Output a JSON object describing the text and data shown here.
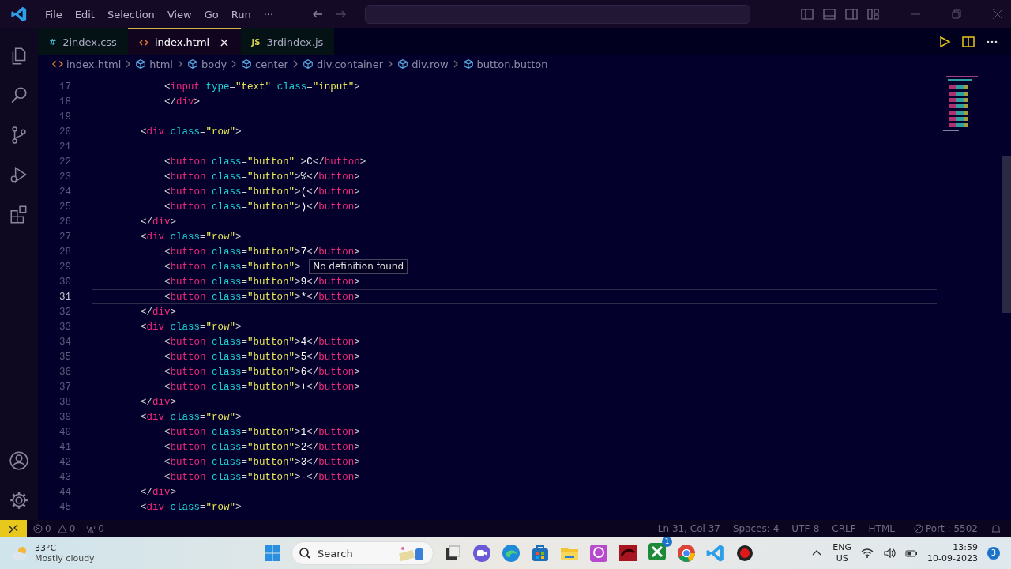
{
  "menu": [
    "File",
    "Edit",
    "Selection",
    "View",
    "Go",
    "Run",
    "···"
  ],
  "tabs": [
    {
      "label": "2index.css",
      "icon": "#",
      "kind": "css",
      "selected": false
    },
    {
      "label": "index.html",
      "kind": "html",
      "selected": true
    },
    {
      "label": "3rdindex.js",
      "icon": "JS",
      "kind": "js",
      "selected": false
    }
  ],
  "close_glyph": "×",
  "breadcrumbs": [
    {
      "label": "index.html",
      "kind": "file"
    },
    {
      "label": "html",
      "kind": "element"
    },
    {
      "label": "body",
      "kind": "element"
    },
    {
      "label": "center",
      "kind": "element"
    },
    {
      "label": "div.container",
      "kind": "element"
    },
    {
      "label": "div.row",
      "kind": "element"
    },
    {
      "label": "button.button",
      "kind": "element"
    }
  ],
  "code_lines": [
    {
      "number": "17",
      "current": false,
      "text": "            <input type=\"text\" class=\"input\">"
    },
    {
      "number": "18",
      "current": false,
      "text": "            </div>"
    },
    {
      "number": "19",
      "current": false
    },
    {
      "number": "20",
      "current": false,
      "text": "        <div class=\"row\">"
    },
    {
      "number": "21",
      "current": false
    },
    {
      "number": "22",
      "current": false,
      "text": "            <button class=\"button\" >C</button>"
    },
    {
      "number": "23",
      "current": false,
      "text": "            <button class=\"button\">%</button>"
    },
    {
      "number": "24",
      "current": false,
      "text": "            <button class=\"button\">(</button>"
    },
    {
      "number": "25",
      "current": false,
      "text": "            <button class=\"button\">)</button>"
    },
    {
      "number": "26",
      "current": false,
      "text": "        </div>"
    },
    {
      "number": "27",
      "current": false,
      "text": "        <div class=\"row\">"
    },
    {
      "number": "28",
      "current": false,
      "text": "            <button class=\"button\">7</button>"
    },
    {
      "number": "29",
      "current": false,
      "text": "            <button class=\"button\">",
      "tooltip": "No definition found"
    },
    {
      "number": "30",
      "current": false,
      "text": "            <button class=\"button\">9</button>"
    },
    {
      "number": "31",
      "current": true,
      "text": "            <button class=\"button\">*</button>"
    },
    {
      "number": "32",
      "current": false,
      "text": "        </div>"
    },
    {
      "number": "33",
      "current": false,
      "text": "        <div class=\"row\">"
    },
    {
      "number": "34",
      "current": false,
      "text": "            <button class=\"button\">4</button>"
    },
    {
      "number": "35",
      "current": false,
      "text": "            <button class=\"button\">5</button>"
    },
    {
      "number": "36",
      "current": false,
      "text": "            <button class=\"button\">6</button>"
    },
    {
      "number": "37",
      "current": false,
      "text": "            <button class=\"button\">+</button>"
    },
    {
      "number": "38",
      "current": false,
      "text": "        </div>"
    },
    {
      "number": "39",
      "current": false,
      "text": "        <div class=\"row\">"
    },
    {
      "number": "40",
      "current": false,
      "text": "            <button class=\"button\">1</button>"
    },
    {
      "number": "41",
      "current": false,
      "text": "            <button class=\"button\">2</button>"
    },
    {
      "number": "42",
      "current": false,
      "text": "            <button class=\"button\">3</button>"
    },
    {
      "number": "43",
      "current": false,
      "text": "            <button class=\"button\">-</button>"
    },
    {
      "number": "44",
      "current": false,
      "text": "        </div>"
    },
    {
      "number": "45",
      "current": false,
      "text": "        <div class=\"row\">"
    }
  ],
  "status_bar": {
    "errors": "0",
    "warnings": "0",
    "ports": "0",
    "right": [
      "Ln 31, Col 37",
      "Spaces: 4",
      "UTF-8",
      "CRLF",
      "HTML"
    ],
    "port": "Port : 5502"
  },
  "taskbar": {
    "temperature": "33°C",
    "weather": "Mostly cloudy",
    "search": "Search",
    "xbox_badge": "1",
    "lang": "ENG",
    "region": "US",
    "time": "13:59",
    "date": "10-09-2023",
    "notifications": "3"
  }
}
